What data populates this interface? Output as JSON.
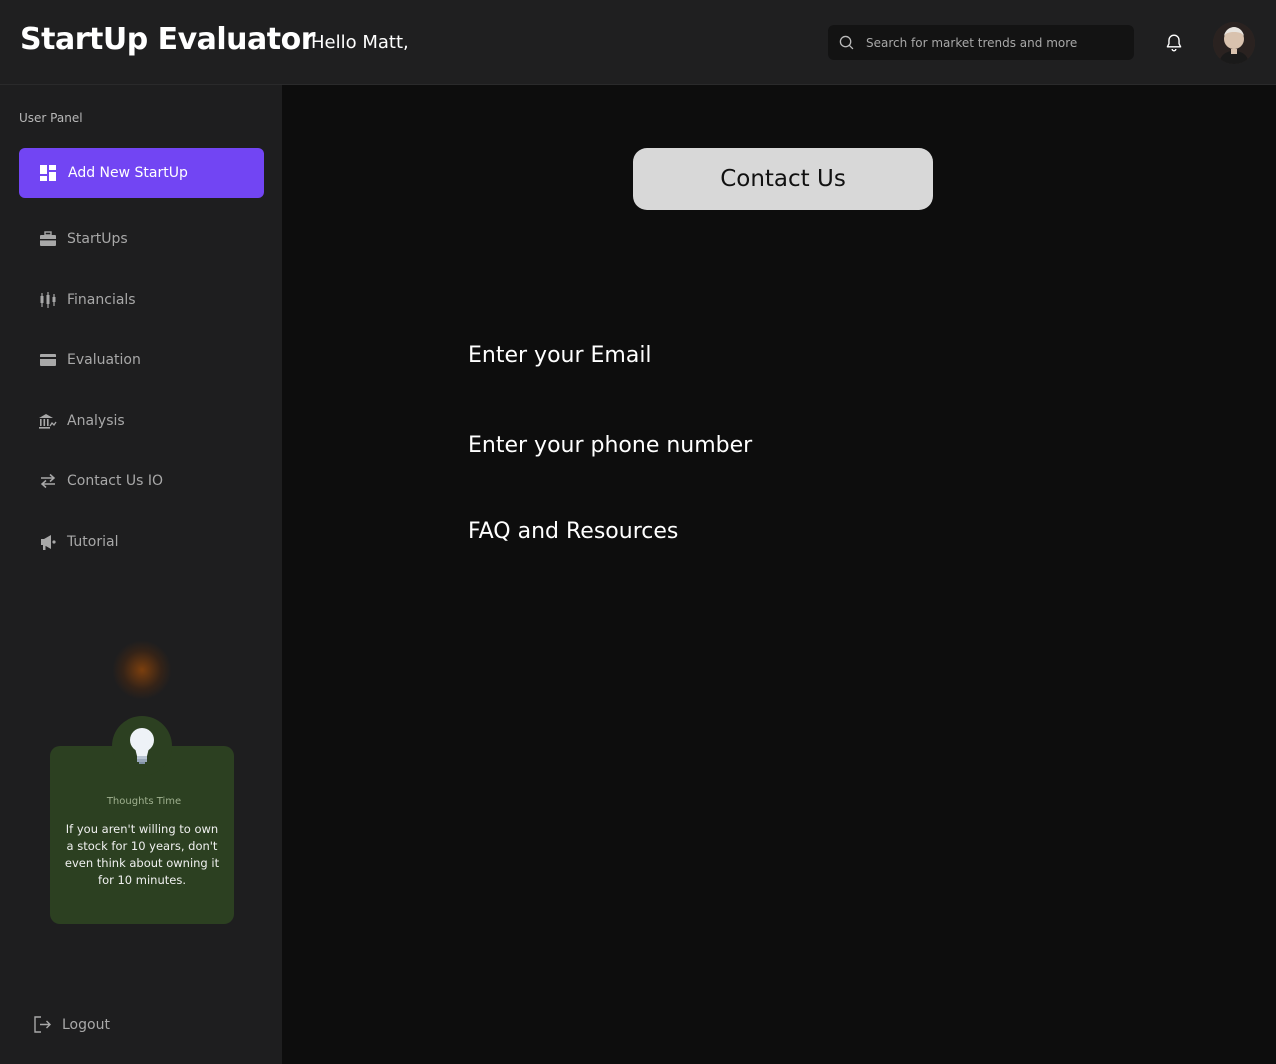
{
  "header": {
    "brand": "StartUp Evaluator",
    "greeting": "Hello Matt,",
    "search_placeholder": "Search for market trends and more"
  },
  "sidebar": {
    "panel_label": "User Panel",
    "primary_button": {
      "label": "Add New StartUp",
      "icon": "dashboard-icon"
    },
    "items": [
      {
        "label": "StartUps",
        "icon": "briefcase-icon"
      },
      {
        "label": "Financials",
        "icon": "candlestick-icon"
      },
      {
        "label": "Evaluation",
        "icon": "card-icon"
      },
      {
        "label": "Analysis",
        "icon": "bank-icon"
      },
      {
        "label": "Contact Us IO",
        "icon": "swap-arrows-icon"
      },
      {
        "label": "Tutorial",
        "icon": "megaphone-icon"
      }
    ],
    "thought": {
      "title": "Thoughts Time",
      "quote": "If you aren't willing to own a stock for 10 years, don't even think about owning it for 10 minutes."
    },
    "logout_label": "Logout"
  },
  "main": {
    "contact_button": "Contact Us",
    "fields": [
      "Enter your Email",
      "Enter your phone number",
      "FAQ and Resources"
    ]
  },
  "colors": {
    "accent": "#7245f3",
    "header_bg": "#1f1f20",
    "sidebar_bg": "#1e1e1f",
    "main_bg": "#0d0d0d",
    "thought_card_bg": "#2c4021",
    "contact_button_bg": "#d8d8d8"
  }
}
